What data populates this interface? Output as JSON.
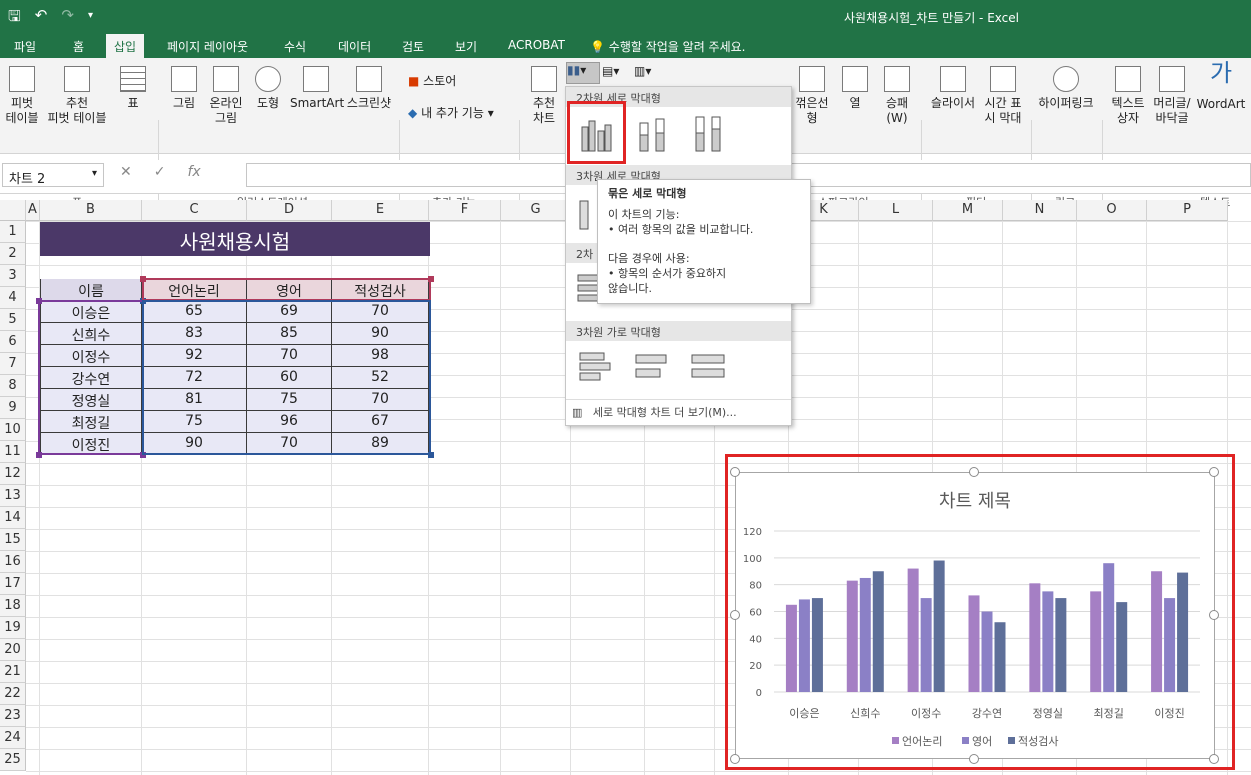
{
  "window": {
    "title": "사원채용시험_차트 만들기 - Excel"
  },
  "ribbon_tabs": [
    "파일",
    "홈",
    "삽입",
    "페이지 레이아웃",
    "수식",
    "데이터",
    "검토",
    "보기",
    "ACROBAT"
  ],
  "tellme": "수행할 작업을 알려 주세요.",
  "ribbon": {
    "pivot1": "피벗",
    "pivot2": "테이블",
    "recpivot1": "추천",
    "recpivot2": "피벗 테이블",
    "table": "표",
    "group_table": "표",
    "picture": "그림",
    "online1": "온라인",
    "online2": "그림",
    "shapes": "도형",
    "smartart": "SmartArt",
    "screenshot": "스크린샷",
    "group_illust": "일러스트레이션",
    "store": "스토어",
    "myaddins": "내 추가 기능",
    "group_addins": "추가 기능",
    "recchart1": "추천",
    "recchart2": "차트",
    "spark_line": "꺾은선형",
    "spark_col": "열",
    "spark_wl1": "승패",
    "spark_wl2": "(W)",
    "group_spark": "스파크라인",
    "slicer": "슬라이서",
    "timeline1": "시간 표",
    "timeline2": "시 막대",
    "group_filter": "필터",
    "hyperlink": "하이퍼링크",
    "group_link": "링크",
    "textbox1": "텍스트",
    "textbox2": "상자",
    "header1": "머리글/",
    "header2": "바닥글",
    "wordart": "WordArt",
    "group_text": "텍스트"
  },
  "namebox": "차트 2",
  "columns": [
    "A",
    "B",
    "C",
    "D",
    "E",
    "F",
    "G",
    "H",
    "I",
    "J",
    "K",
    "L",
    "M",
    "N",
    "O",
    "P"
  ],
  "rows": [
    "1",
    "2",
    "3",
    "4",
    "5",
    "6",
    "7",
    "8",
    "9",
    "10",
    "11",
    "12",
    "13",
    "14",
    "15",
    "16",
    "17",
    "18",
    "19",
    "20",
    "21",
    "22",
    "23",
    "24",
    "25"
  ],
  "sheet": {
    "title": "사원채용시험",
    "headers": [
      "이름",
      "언어논리",
      "영어",
      "적성검사"
    ],
    "data": [
      [
        "이승은",
        "65",
        "69",
        "70"
      ],
      [
        "신희수",
        "83",
        "85",
        "90"
      ],
      [
        "이정수",
        "92",
        "70",
        "98"
      ],
      [
        "강수연",
        "72",
        "60",
        "52"
      ],
      [
        "정영실",
        "81",
        "75",
        "70"
      ],
      [
        "최정길",
        "75",
        "96",
        "67"
      ],
      [
        "이정진",
        "90",
        "70",
        "89"
      ]
    ]
  },
  "dropdown": {
    "sec1": "2차원 세로 막대형",
    "sec2": "3차원 세로 막대형",
    "sec3": "2차",
    "sec4": "3차원 가로 막대형",
    "more": "세로 막대형 차트 더 보기(M)..."
  },
  "tooltip": {
    "title": "묶은 세로 막대형",
    "l1": "이 차트의 기능:",
    "l2": "• 여러 항목의 값을 비교합니다.",
    "l3": "다음 경우에 사용:",
    "l4": "• 항목의 순서가 중요하지",
    "l5": "않습니다."
  },
  "chart_data": {
    "type": "bar",
    "title": "차트 제목",
    "categories": [
      "이승은",
      "신희수",
      "이정수",
      "강수연",
      "정영실",
      "최정길",
      "이정진"
    ],
    "series": [
      {
        "name": "언어논리",
        "values": [
          65,
          83,
          92,
          72,
          81,
          75,
          90
        ],
        "color": "#a57fc4"
      },
      {
        "name": "영어",
        "values": [
          69,
          85,
          70,
          60,
          75,
          96,
          70
        ],
        "color": "#8b80c6"
      },
      {
        "name": "적성검사",
        "values": [
          70,
          90,
          98,
          52,
          70,
          67,
          89
        ],
        "color": "#5e6f99"
      }
    ],
    "ylim": [
      0,
      120
    ],
    "yticks": [
      "0",
      "20",
      "40",
      "60",
      "80",
      "100",
      "120"
    ],
    "grid": true,
    "legend": "bottom"
  },
  "colors": {
    "excel_green": "#217346",
    "title_fill": "#4b3868",
    "highlight_red": "#e02424"
  }
}
